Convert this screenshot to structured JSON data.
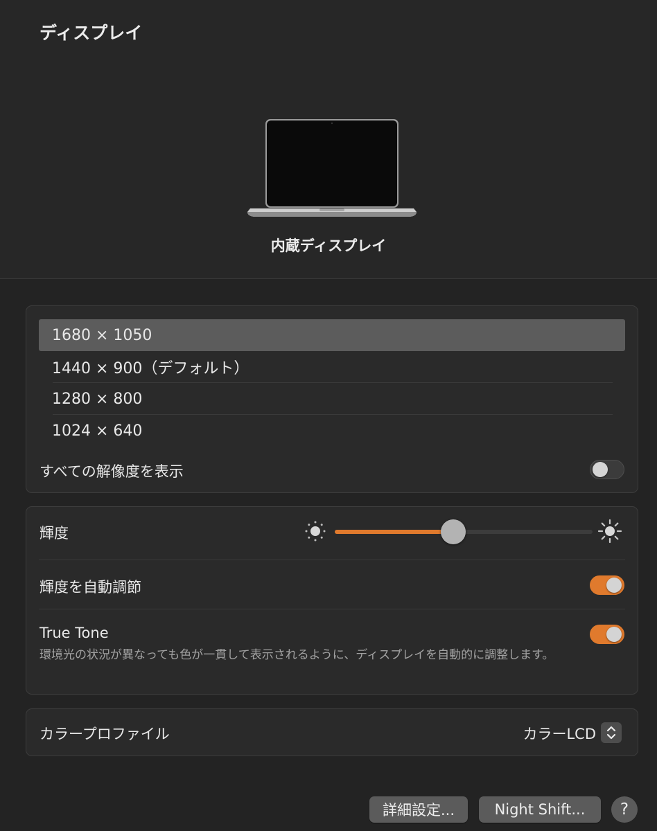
{
  "header": {
    "title": "ディスプレイ"
  },
  "display": {
    "name": "内蔵ディスプレイ"
  },
  "resolutions": {
    "options": [
      "1680 × 1050",
      "1440 × 900（デフォルト）",
      "1280 × 800",
      "1024 × 640"
    ],
    "selected_index": 0,
    "show_all_label": "すべての解像度を表示",
    "show_all_on": false
  },
  "brightness": {
    "label": "輝度",
    "value": 0.46,
    "auto_label": "輝度を自動調節",
    "auto_on": true,
    "true_tone_label": "True Tone",
    "true_tone_on": true,
    "true_tone_desc": "環境光の状況が異なっても色が一貫して表示されるように、ディスプレイを自動的に調整します。"
  },
  "color_profile": {
    "label": "カラープロファイル",
    "value": "カラーLCD"
  },
  "buttons": {
    "advanced": "詳細設定...",
    "night_shift": "Night Shift...",
    "help": "?"
  },
  "colors": {
    "accent": "#e07a2d",
    "background": "#232323",
    "panel": "#2a2a2a",
    "selected_row": "#5c5c5c"
  },
  "icons": {
    "brightness_low": "sun-small-icon",
    "brightness_high": "sun-large-icon",
    "stepper": "chevron-up-down-icon"
  }
}
